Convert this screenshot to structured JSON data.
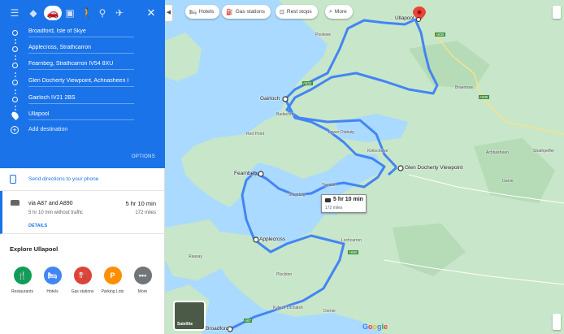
{
  "modes": [
    {
      "name": "best-icon"
    },
    {
      "name": "drive-icon",
      "active": true
    },
    {
      "name": "transit-icon"
    },
    {
      "name": "walk-icon"
    },
    {
      "name": "bicycle-icon"
    },
    {
      "name": "flight-icon"
    }
  ],
  "stops": [
    {
      "label": "Broadford, Isle of Skye"
    },
    {
      "label": "Applecross, Strathcarron"
    },
    {
      "label": "Fearnbeg, Strathcarron IV54 8XU"
    },
    {
      "label": "Glen Docherty Viewpoint, Achnasheen I"
    },
    {
      "label": "Gairloch IV21 2BS"
    },
    {
      "label": "Ullapool"
    }
  ],
  "add_destination": "Add destination",
  "options": "OPTIONS",
  "send_directions": "Send directions to your phone",
  "route": {
    "via": "via A87 and A890",
    "time": "5 hr 10 min",
    "traffic": "5 hr 10 min without traffic",
    "distance": "172 miles",
    "details": "DETAILS"
  },
  "explore": {
    "title": "Explore Ullapool",
    "categories": [
      {
        "label": "Restaurants",
        "color": "#0f9d58",
        "icon": "restaurant-icon"
      },
      {
        "label": "Hotels",
        "color": "#4285f4",
        "icon": "hotel-icon"
      },
      {
        "label": "Gas stations",
        "color": "#db4437",
        "icon": "gas-station-icon"
      },
      {
        "label": "Parking Lots",
        "color": "#ff8f00",
        "icon": "parking-icon"
      },
      {
        "label": "More",
        "color": "#70757a",
        "icon": "more-icon"
      }
    ]
  },
  "map": {
    "chips": [
      {
        "label": "Hotels",
        "icon": "hotel-icon"
      },
      {
        "label": "Gas stations",
        "icon": "gas-station-icon"
      },
      {
        "label": "Rest stops",
        "icon": "rest-stop-icon"
      },
      {
        "label": "More",
        "icon": "search-icon"
      }
    ],
    "places": [
      {
        "label": "Ullapool"
      },
      {
        "label": "Gairloch"
      },
      {
        "label": "Glen Docherty Viewpoint"
      },
      {
        "label": "Fearnbeg"
      },
      {
        "label": "Applecross"
      },
      {
        "label": "Broadford"
      }
    ],
    "small_places": [
      "Poolewe",
      "Badachro",
      "Red Point",
      "Lower Diabaig",
      "Shieldaig",
      "Torridon",
      "Kinlochewe",
      "Achnasheen",
      "Lochcarron",
      "Plockton",
      "Raasay",
      "Kyle of Lochalsh",
      "Dornie",
      "Strathpeffer",
      "Braemore",
      "Garve"
    ],
    "road_labels": [
      "A835",
      "A835",
      "A832",
      "A890",
      "A87"
    ],
    "route_box": {
      "time": "5 hr 10 min",
      "distance": "172 miles"
    },
    "satellite_label": "Satellite",
    "google": "Google",
    "colors": {
      "route": "#4285f4",
      "land": "#c8e6c9",
      "water": "#aadaff",
      "pin": "#ea4335"
    }
  }
}
